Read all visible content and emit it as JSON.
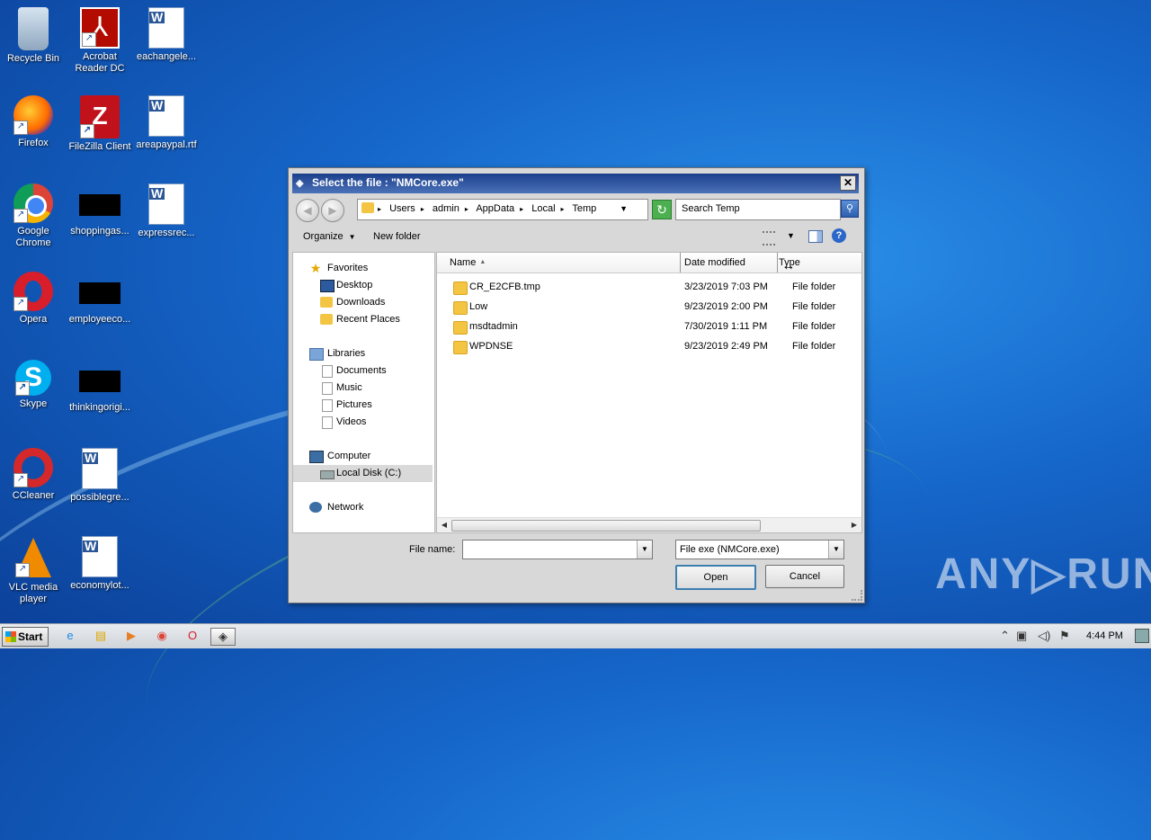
{
  "desktop": {
    "icons": [
      {
        "label": "Recycle Bin",
        "icon": "recycle-bin-icon"
      },
      {
        "label": "Acrobat\nReader DC",
        "icon": "acrobat-reader-icon"
      },
      {
        "label": "eachangele...",
        "icon": "word-document-icon"
      },
      {
        "label": "Firefox",
        "icon": "firefox-icon"
      },
      {
        "label": "FileZilla Client",
        "icon": "filezilla-icon"
      },
      {
        "label": "areapaypal.rtf",
        "icon": "word-document-icon"
      },
      {
        "label": "Google\nChrome",
        "icon": "chrome-icon"
      },
      {
        "label": "shoppingas...",
        "icon": "black-file-icon"
      },
      {
        "label": "expressrec...",
        "icon": "word-document-icon"
      },
      {
        "label": "Opera",
        "icon": "opera-icon"
      },
      {
        "label": "employeeco...",
        "icon": "black-file-icon"
      },
      {
        "label": "Skype",
        "icon": "skype-icon"
      },
      {
        "label": "thinkingorigi...",
        "icon": "black-file-icon"
      },
      {
        "label": "CCleaner",
        "icon": "ccleaner-icon"
      },
      {
        "label": "possiblegre...",
        "icon": "word-document-icon"
      },
      {
        "label": "VLC media\nplayer",
        "icon": "vlc-icon"
      },
      {
        "label": "economylot...",
        "icon": "word-document-icon"
      }
    ]
  },
  "dialog": {
    "title": "Select the file : \"NMCore.exe\"",
    "close_label": "✕",
    "breadcrumbs": [
      "Users",
      "admin",
      "AppData",
      "Local",
      "Temp"
    ],
    "search_placeholder": "Search Temp",
    "toolbar": {
      "organize_label": "Organize",
      "new_folder_label": "New folder",
      "help_label": "?"
    },
    "nav": {
      "favorites": "Favorites",
      "desktop": "Desktop",
      "downloads": "Downloads",
      "recent_places": "Recent Places",
      "libraries": "Libraries",
      "documents": "Documents",
      "music": "Music",
      "pictures": "Pictures",
      "videos": "Videos",
      "computer": "Computer",
      "local_disk": "Local Disk (C:)",
      "network": "Network"
    },
    "columns": {
      "name": "Name",
      "date_modified": "Date modified",
      "type": "Type"
    },
    "files": [
      {
        "name": "CR_E2CFB.tmp",
        "date": "3/23/2019 7:03 PM",
        "type": "File folder"
      },
      {
        "name": "Low",
        "date": "9/23/2019 2:00 PM",
        "type": "File folder"
      },
      {
        "name": "msdtadmin",
        "date": "7/30/2019 1:11 PM",
        "type": "File folder"
      },
      {
        "name": "WPDNSE",
        "date": "9/23/2019 2:49 PM",
        "type": "File folder"
      }
    ],
    "file_name_label": "File name:",
    "file_name_value": "",
    "filter_value": "File exe (NMCore.exe)",
    "open_label": "Open",
    "cancel_label": "Cancel"
  },
  "watermark": "ANY▷RUN",
  "taskbar": {
    "start_label": "Start",
    "clock": "4:44 PM"
  }
}
